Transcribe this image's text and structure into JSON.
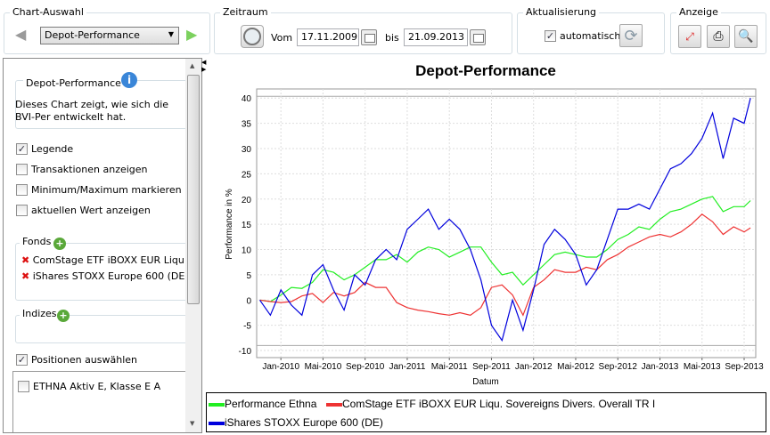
{
  "toolbar": {
    "chart_group": "Chart-Auswahl",
    "chart_select": "Depot-Performance",
    "period_group": "Zeitraum",
    "from_label": "Vom",
    "from_date": "17.11.2009",
    "to_label": "bis",
    "to_date": "21.09.2013",
    "refresh_group": "Aktualisierung",
    "auto_label": "automatisch",
    "view_group": "Anzeige"
  },
  "sidebar": {
    "info_title": "Depot-Performance",
    "info_text": "Dieses Chart zeigt, wie sich die BVI-Per entwickelt hat.",
    "options": [
      {
        "label": "Legende",
        "checked": true
      },
      {
        "label": "Transaktionen anzeigen",
        "checked": false
      },
      {
        "label": "Minimum/Maximum markieren",
        "checked": false
      },
      {
        "label": "aktuellen Wert anzeigen",
        "checked": false
      }
    ],
    "funds_title": "Fonds",
    "funds": [
      "ComStage ETF iBOXX EUR Liqu. Sovereigns Divers. Overall TR I",
      "iShares STOXX Europe 600 (DE)"
    ],
    "indices_title": "Indizes",
    "positions_label": "Positionen auswählen",
    "positions": [
      "ETHNA Aktiv E, Klasse E A"
    ]
  },
  "chart_data": {
    "type": "line",
    "title": "Depot-Performance",
    "xlabel": "Datum",
    "ylabel": "Performance in %",
    "ylim": [
      -11.4,
      41.8
    ],
    "yticks": [
      -10,
      -5,
      0,
      5,
      10,
      15,
      20,
      25,
      30,
      35,
      40
    ],
    "xticks": [
      {
        "label": "Jan-2010",
        "m": 2
      },
      {
        "label": "Mai-2010",
        "m": 6
      },
      {
        "label": "Sep-2010",
        "m": 10
      },
      {
        "label": "Jan-2011",
        "m": 14
      },
      {
        "label": "Mai-2011",
        "m": 18
      },
      {
        "label": "Sep-2011",
        "m": 22
      },
      {
        "label": "Jan-2012",
        "m": 26
      },
      {
        "label": "Mai-2012",
        "m": 30
      },
      {
        "label": "Sep-2012",
        "m": 34
      },
      {
        "label": "Jan-2013",
        "m": 38
      },
      {
        "label": "Mai-2013",
        "m": 42
      },
      {
        "label": "Sep-2013",
        "m": 46
      }
    ],
    "x_months_since_nov_2009": [
      0,
      1,
      2,
      3,
      4,
      5,
      6,
      7,
      8,
      9,
      10,
      11,
      12,
      13,
      14,
      15,
      16,
      17,
      18,
      19,
      20,
      21,
      22,
      23,
      24,
      25,
      26,
      27,
      28,
      29,
      30,
      31,
      32,
      33,
      34,
      35,
      36,
      37,
      38,
      39,
      40,
      41,
      42,
      43,
      44,
      45,
      46,
      46.6
    ],
    "xlim": [
      -0.3,
      47.1
    ],
    "series": [
      {
        "name": "Performance Ethna",
        "color": "#22ee22",
        "values": [
          0,
          -0.3,
          1,
          2.5,
          2.3,
          3.5,
          6,
          5.5,
          4,
          5,
          6.5,
          8,
          8,
          9,
          7.5,
          9.5,
          10.5,
          10,
          8.5,
          9.5,
          10.5,
          10.5,
          7.5,
          5,
          5.5,
          3,
          5,
          7,
          9,
          9.5,
          9,
          8.5,
          8.5,
          10,
          12,
          13,
          14.5,
          14,
          16,
          17.5,
          18,
          19,
          20,
          20.5,
          17.5,
          18.5,
          18.5,
          19.7
        ]
      },
      {
        "name": "ComStage ETF iBOXX EUR Liqu. Sovereigns Divers. Overall TR I",
        "color": "#ee3333",
        "values": [
          0,
          -0.3,
          -0.5,
          -0.3,
          0.8,
          1.3,
          -0.5,
          1.5,
          0.8,
          1.5,
          3.5,
          2.5,
          2.5,
          -0.5,
          -1.5,
          -2,
          -2.3,
          -2.7,
          -3,
          -2.5,
          -3,
          -1.5,
          2.5,
          3,
          1,
          -3,
          2.5,
          4,
          6,
          5.5,
          5.5,
          6.5,
          6,
          8,
          9,
          10.5,
          11.5,
          12.5,
          13,
          12.5,
          13.5,
          15,
          17,
          15.5,
          13,
          14.5,
          13.5,
          14.3
        ]
      },
      {
        "name": "iShares STOXX Europe 600 (DE)",
        "color": "#0000dd",
        "values": [
          0,
          -3,
          2,
          -1,
          -3,
          5,
          7,
          2,
          -2,
          5,
          3,
          8,
          10,
          8,
          14,
          16,
          18,
          14,
          16,
          14,
          10,
          4,
          -5,
          -8,
          0,
          -6,
          2,
          11,
          14,
          12,
          9,
          3,
          6,
          12,
          18,
          18,
          19,
          18,
          22,
          26,
          27,
          29,
          32,
          37,
          28,
          36,
          35,
          40
        ]
      }
    ],
    "legend": "bottom"
  }
}
